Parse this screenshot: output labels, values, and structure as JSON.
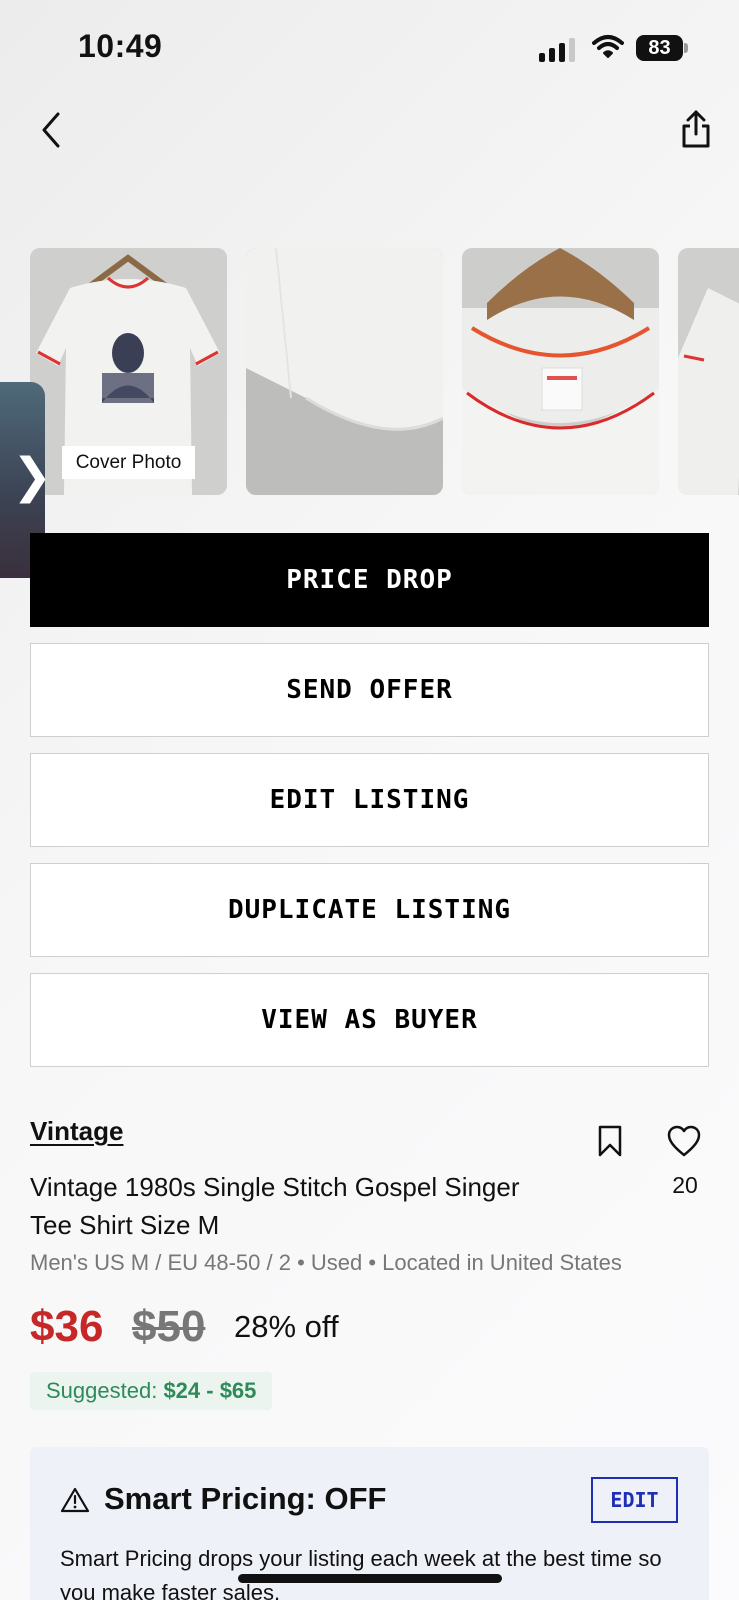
{
  "status_bar": {
    "time": "10:49",
    "battery_percent": "83",
    "signal_bars_active": 3,
    "signal_bars_total": 4
  },
  "nav": {
    "back_icon": "chevron-left-icon",
    "share_icon": "share-icon"
  },
  "photos": {
    "cover_label": "Cover Photo",
    "items": [
      {
        "name": "white-tee-front-with-portrait-print"
      },
      {
        "name": "fabric-hem-closeup"
      },
      {
        "name": "collar-tag-on-hanger"
      },
      {
        "name": "tee-partial-side-view"
      }
    ]
  },
  "side_tab": {
    "arrow": "❯"
  },
  "actions": {
    "price_drop": "PRICE DROP",
    "send_offer": "SEND OFFER",
    "edit_listing": "EDIT LISTING",
    "duplicate_listing": "DUPLICATE LISTING",
    "view_as_buyer": "VIEW AS BUYER"
  },
  "listing": {
    "brand": "Vintage",
    "likes": "20",
    "title": "Vintage 1980s Single Stitch Gospel Singer Tee Shirt Size M",
    "meta": "Men's US M / EU 48-50 / 2  •  Used  •  Located in United States",
    "price": "$36",
    "original_price": "$50",
    "discount": "28% off",
    "suggested_label": "Suggested: ",
    "suggested_range": "$24 - $65"
  },
  "smart_pricing": {
    "title": "Smart Pricing: OFF",
    "edit_label": "EDIT",
    "description": "Smart Pricing drops your listing each week at the best time so you make faster sales."
  },
  "colors": {
    "price_red": "#c62828",
    "suggested_green": "#2f8a5a",
    "edit_blue": "#1f2fb3",
    "primary_black": "#000000"
  }
}
